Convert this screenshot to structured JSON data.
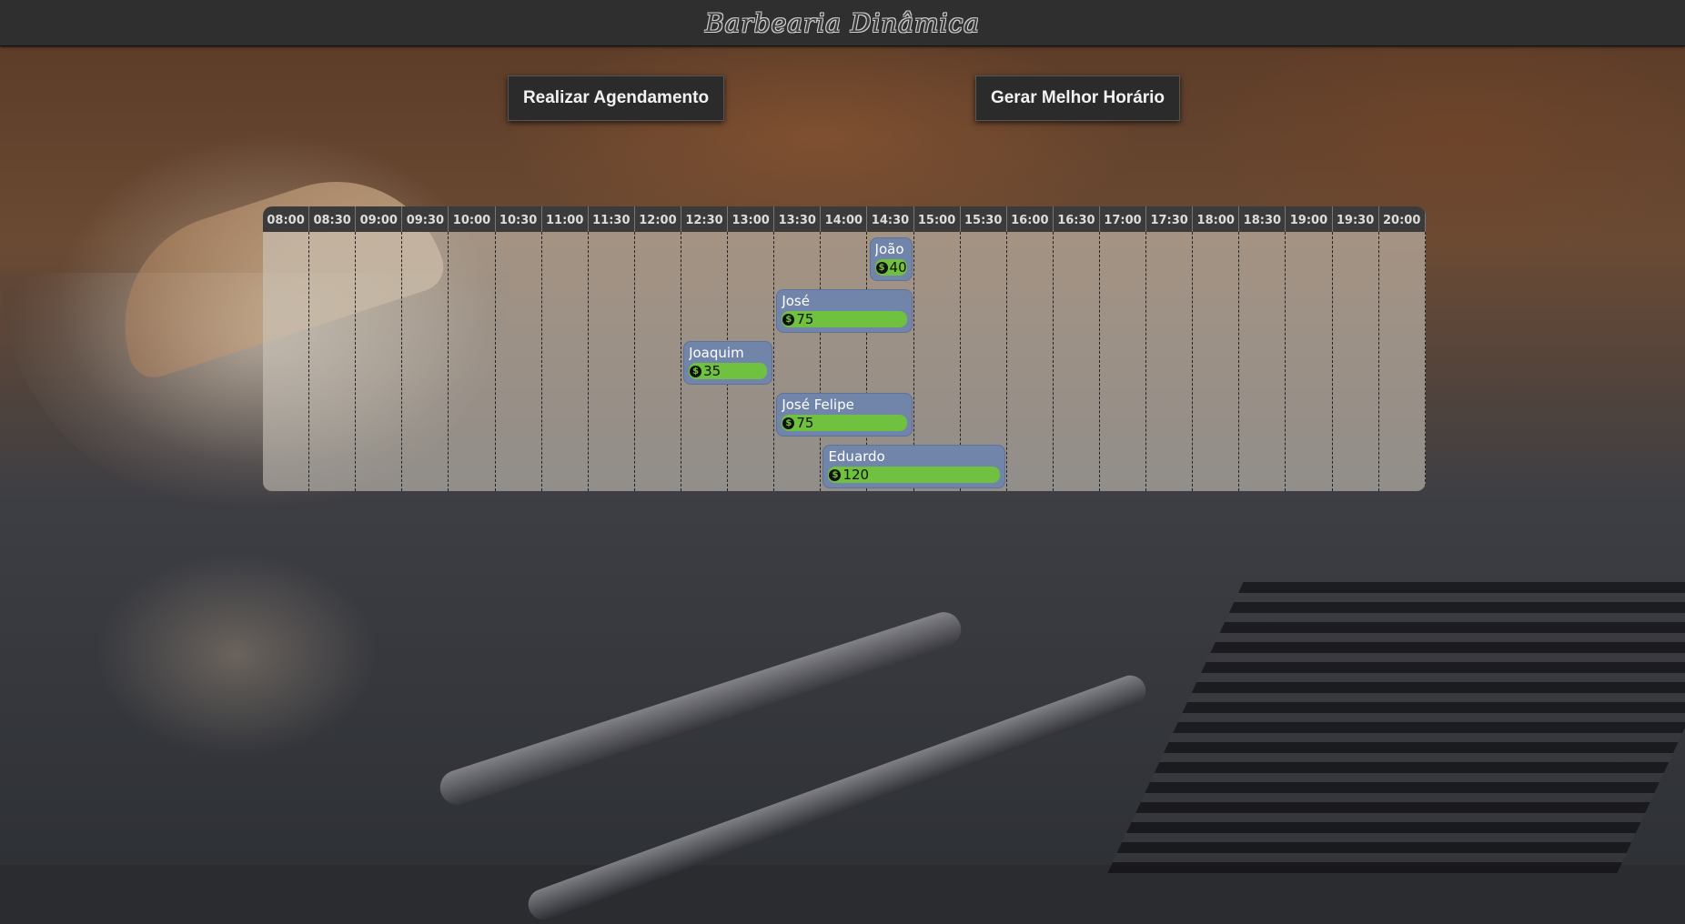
{
  "header": {
    "brand": "Barbearia Dinâmica"
  },
  "actions": {
    "schedule_label": "Realizar Agendamento",
    "best_time_label": "Gerar Melhor Horário"
  },
  "timeline": {
    "hours": [
      "08:00",
      "08:30",
      "09:00",
      "09:30",
      "10:00",
      "10:30",
      "11:00",
      "11:30",
      "12:00",
      "12:30",
      "13:00",
      "13:30",
      "14:00",
      "14:30",
      "15:00",
      "15:30",
      "16:00",
      "16:30",
      "17:00",
      "17:30",
      "18:00",
      "18:30",
      "19:00",
      "19:30",
      "20:00"
    ],
    "appointments": [
      {
        "name": "João",
        "price": "40",
        "start": "14:30",
        "end": "15:00"
      },
      {
        "name": "José",
        "price": "75",
        "start": "13:30",
        "end": "15:00"
      },
      {
        "name": "Joaquim",
        "price": "35",
        "start": "12:30",
        "end": "13:30"
      },
      {
        "name": "José Felipe",
        "price": "75",
        "start": "13:30",
        "end": "15:00"
      },
      {
        "name": "Eduardo",
        "price": "120",
        "start": "14:00",
        "end": "16:00"
      }
    ]
  },
  "colors": {
    "appointment_bg": "#7085a9",
    "price_bar": "#6fc13f",
    "topbar": "#2f2f2f"
  },
  "icons": {
    "price": "dollar-coin-icon"
  }
}
